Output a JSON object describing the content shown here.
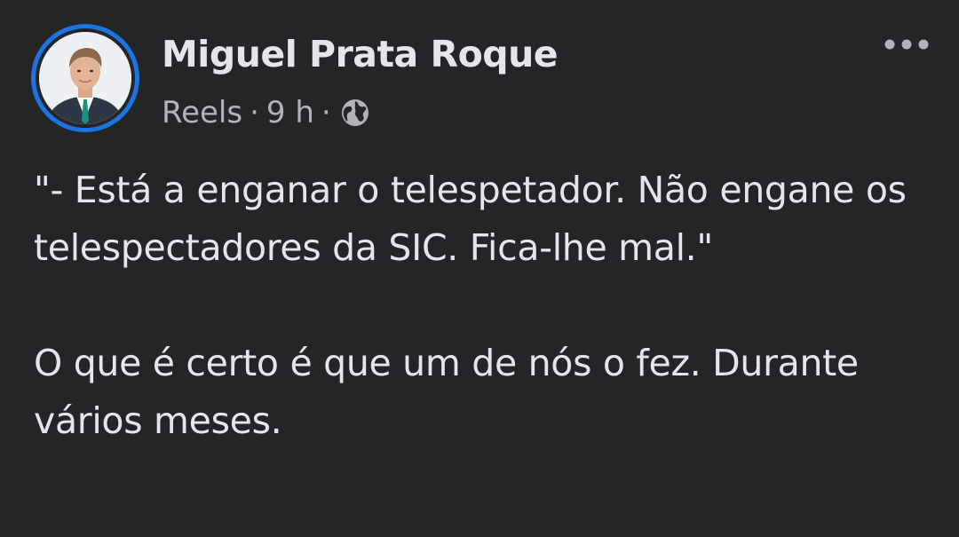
{
  "post": {
    "author": {
      "name": "Miguel Prata Roque",
      "avatar_icon": "profile-photo"
    },
    "meta": {
      "source": "Reels",
      "separator": "·",
      "time": "9 h",
      "audience_icon": "globe-icon"
    },
    "more_icon": "more-options-icon",
    "text": "\"- Está a enganar o telespetador. Não engane os telespectadores da SIC. Fica-lhe mal.\"\n\nO que é certo é que um de nós o fez. Durante vários meses."
  },
  "colors": {
    "background": "#242526",
    "primary_text": "#e4e6eb",
    "secondary_text": "#b0b3b8",
    "story_ring": "#1b74e4"
  }
}
